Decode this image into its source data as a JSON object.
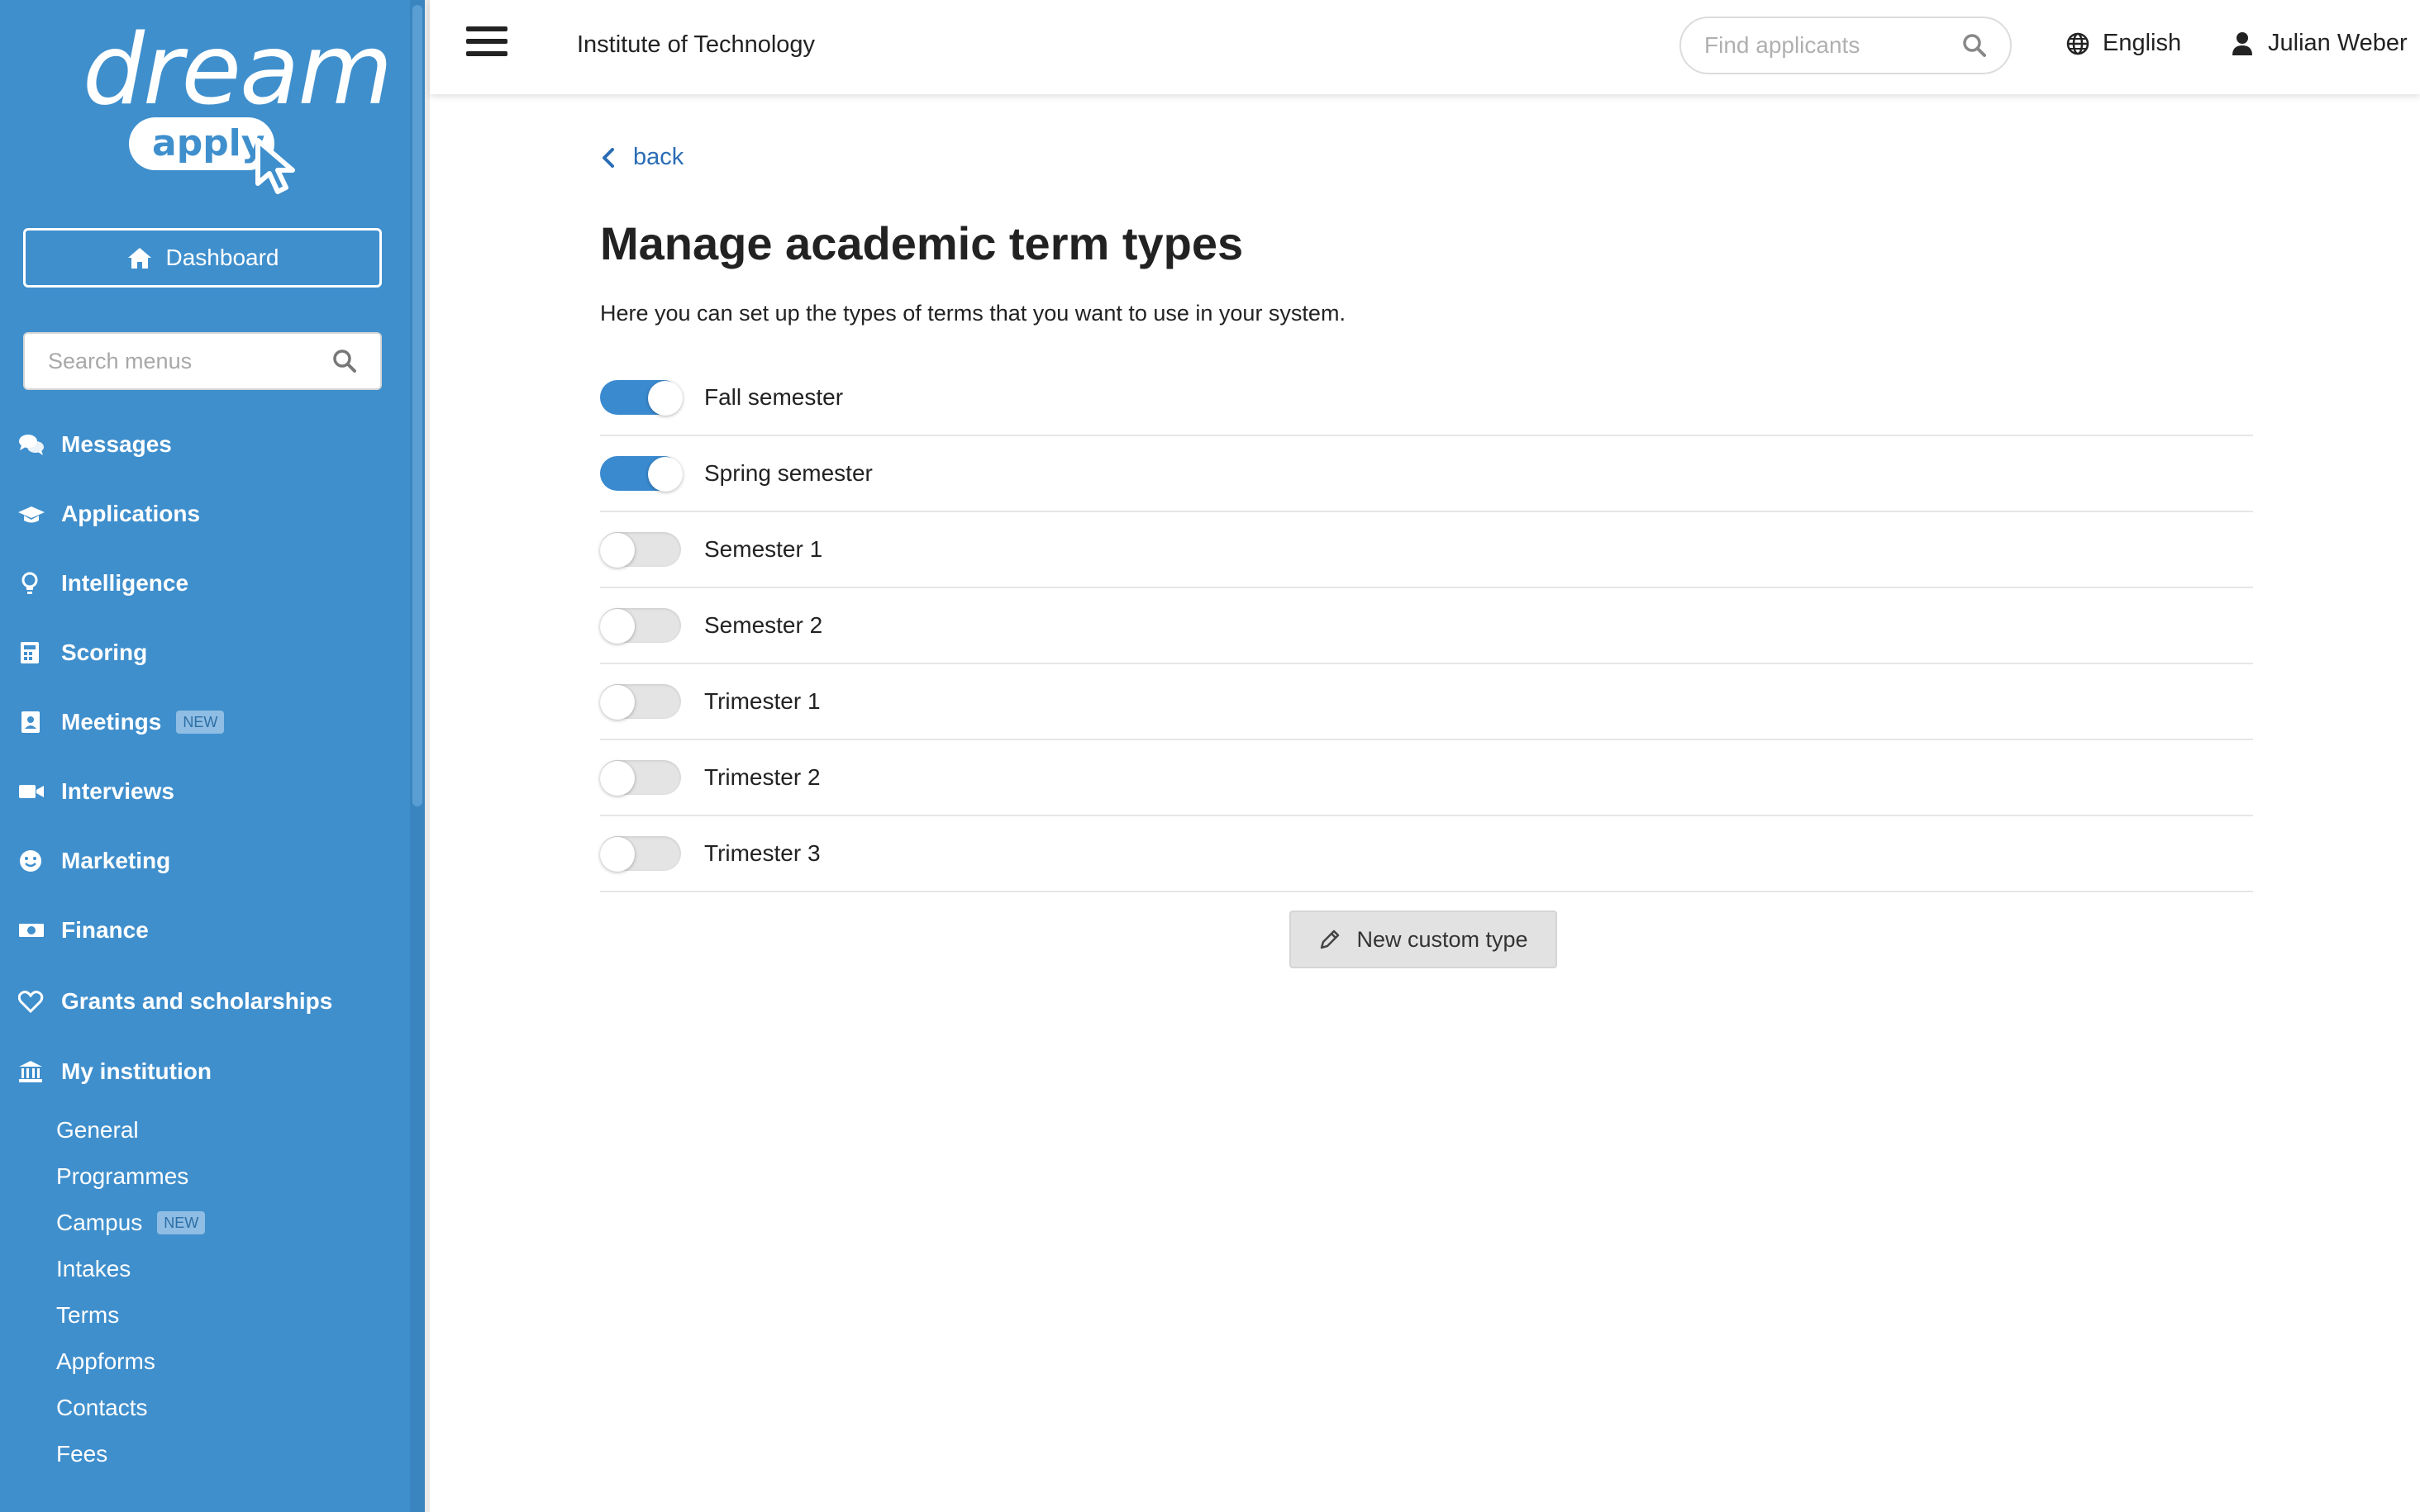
{
  "brand": {
    "logo_word_1": "dream",
    "logo_word_2": "apply"
  },
  "sidebar": {
    "dashboard_label": "Dashboard",
    "search_placeholder": "Search menus",
    "badge_new": "NEW",
    "items": [
      {
        "label": "Messages",
        "icon": "comments-icon"
      },
      {
        "label": "Applications",
        "icon": "graduation-cap-icon"
      },
      {
        "label": "Intelligence",
        "icon": "lightbulb-icon"
      },
      {
        "label": "Scoring",
        "icon": "calculator-icon"
      },
      {
        "label": "Meetings",
        "icon": "address-book-icon",
        "badge": "NEW"
      },
      {
        "label": "Interviews",
        "icon": "video-icon"
      },
      {
        "label": "Marketing",
        "icon": "smile-icon"
      },
      {
        "label": "Finance",
        "icon": "money-bill-icon"
      },
      {
        "label": "Grants and scholarships",
        "icon": "heart-icon"
      },
      {
        "label": "My institution",
        "icon": "institution-icon"
      }
    ],
    "sub_items": [
      {
        "label": "General"
      },
      {
        "label": "Programmes"
      },
      {
        "label": "Campus",
        "badge": "NEW"
      },
      {
        "label": "Intakes"
      },
      {
        "label": "Terms"
      },
      {
        "label": "Appforms"
      },
      {
        "label": "Contacts"
      },
      {
        "label": "Fees"
      }
    ]
  },
  "topbar": {
    "institution": "Institute of Technology",
    "search_placeholder": "Find applicants",
    "language": "English",
    "user": "Julian Weber"
  },
  "main": {
    "back_label": "back",
    "title": "Manage academic term types",
    "description": "Here you can set up the types of terms that you want to use in your system.",
    "terms": [
      {
        "label": "Fall semester",
        "enabled": true
      },
      {
        "label": "Spring semester",
        "enabled": true
      },
      {
        "label": "Semester 1",
        "enabled": false
      },
      {
        "label": "Semester 2",
        "enabled": false
      },
      {
        "label": "Trimester 1",
        "enabled": false
      },
      {
        "label": "Trimester 2",
        "enabled": false
      },
      {
        "label": "Trimester 3",
        "enabled": false
      }
    ],
    "new_type_label": "New custom type"
  },
  "colors": {
    "sidebar": "#3f8fcd",
    "toggle_on": "#3a8ad0",
    "link": "#2a6db5"
  }
}
